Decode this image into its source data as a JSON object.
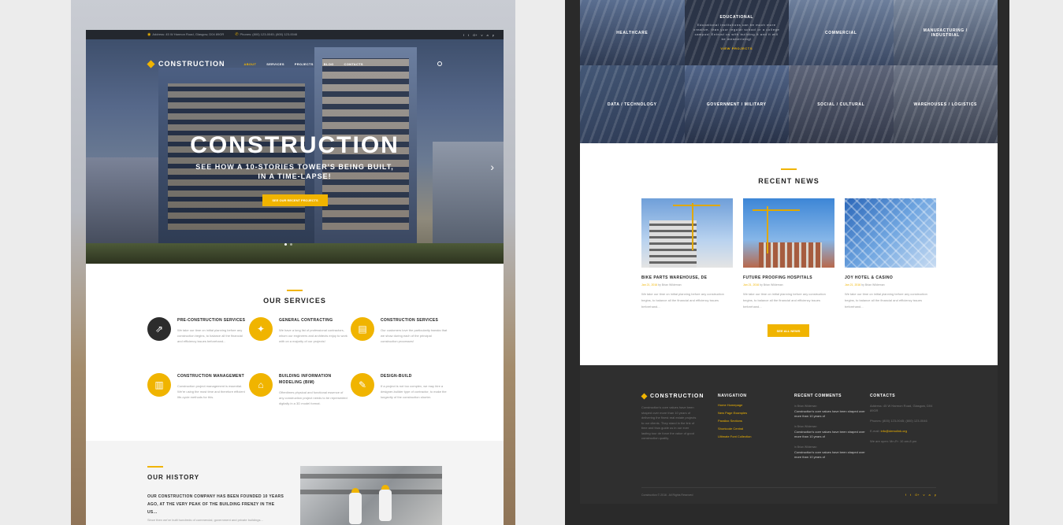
{
  "left": {
    "topbar": {
      "address": "Address: 45 W Harmon Road, Glasgow, D04 89GR",
      "phones": "Phones: (800) 123-0045; (800) 123-0046",
      "social": [
        "f",
        "t",
        "G+",
        "v",
        "a",
        "p"
      ]
    },
    "nav": {
      "logo": "CONSTRUCTION",
      "items": [
        "ABOUT",
        "SERVICES",
        "PROJECTS",
        "BLOG",
        "CONTACTS"
      ],
      "active": "ABOUT"
    },
    "hero": {
      "title": "CONSTRUCTION",
      "subtitle_line1": "SEE HOW A 10-STORIES TOWER'S BEING BUILT,",
      "subtitle_line2": "IN A TIME-LAPSE!",
      "button": "SEE OUR RECENT PROJECTS",
      "arrow": "›"
    },
    "services": {
      "title": "OUR SERVICES",
      "items": [
        {
          "name": "PRE-CONSTRUCTION SERVICES",
          "text": "We take our time on initial planning before any construction begins, to balance all the financial and efficiency issues beforehand...",
          "icon": "chart-icon",
          "glyph": "⇗"
        },
        {
          "name": "GENERAL CONTRACTING",
          "text": "We have a long list of professional contractors, whom our engineers and architects enjoy to work with on a majority of our projects!",
          "icon": "handshake-icon",
          "glyph": "✦"
        },
        {
          "name": "CONSTRUCTION SERVICES",
          "text": "Our customers love the particularity tweaks that we show during each of the principal construction processes!",
          "icon": "crane-icon",
          "glyph": "▤"
        },
        {
          "name": "CONSTRUCTION MANAGEMENT",
          "text": "Construction project management is essential. We're using the most time and therefore efficient life-cycle methods for this.",
          "icon": "clipboard-icon",
          "glyph": "▥"
        },
        {
          "name": "BUILDING INFORMATION MODELING (BIM)",
          "text": "Oftentimes physical and functional essence of any construction project needs to be represented digitally in a 3D model format.",
          "icon": "house-icon",
          "glyph": "⌂"
        },
        {
          "name": "DESIGN-BUILD",
          "text": "If a project is not too complex, we may hire a designer-builder type of contractor, to make the longevity of the construction shorter.",
          "icon": "pencil-icon",
          "glyph": "✎"
        }
      ]
    },
    "history": {
      "title": "OUR HISTORY",
      "text": "OUR CONSTRUCTION COMPANY HAS BEEN FOUNDED 10 YEARS AGO, AT THE VERY PEAK OF THE BUILDING FRENZY IN THE US...",
      "small": "Since then we've built hundreds of commercial, government and private buildings..."
    }
  },
  "right": {
    "tiles": [
      {
        "label": "HEALTHCARE"
      },
      {
        "label": "EDUCATIONAL",
        "desc": "Educational institutions can be much more creative, than your regular school or a college campus! Entrust us with building it and it will be mesmerizing!",
        "link": "VIEW PROJECTS"
      },
      {
        "label": "COMMERCIAL"
      },
      {
        "label": "MANUFACTURING / INDUSTRIAL"
      },
      {
        "label": "DATA / TECHNOLOGY"
      },
      {
        "label": "GOVERNMENT / MILITARY"
      },
      {
        "label": "SOCIAL / CULTURAL"
      },
      {
        "label": "WAREHOUSES / LOGISTICS"
      }
    ],
    "news": {
      "title": "RECENT NEWS",
      "posts": [
        {
          "title": "BIKE PARTS WAREHOUSE, DE",
          "date": "Jan 21, 2016",
          "by": "by Brian Wildeman",
          "text": "We take our time on initial planning before any construction begins, to balance all the financial and efficiency issues beforehand..."
        },
        {
          "title": "FUTURE PROOFING HOSPITALS",
          "date": "Jan 21, 2016",
          "by": "by Brian Wildeman",
          "text": "We take our time on initial planning before any construction begins, to balance all the financial and efficiency issues beforehand..."
        },
        {
          "title": "JOY HOTEL & CASINO",
          "date": "Jan 21, 2016",
          "by": "by Brian Wildeman",
          "text": "We take our time on initial planning before any construction begins, to balance all the financial and efficiency issues beforehand..."
        }
      ],
      "button": "SEE ALL NEWS"
    },
    "footer": {
      "logo": "CONSTRUCTION",
      "about": "Construction's core values have been shaped over more than 10 years of delivering the finest real estate projects to our clients. They stand in the link of time and thus guide us in our ever lasting tour de force the value of good construction quality.",
      "nav_title": "NAVIGATION",
      "nav_links": [
        "Home Homepage",
        "New Page Examples",
        "Parallax Sections",
        "Shortcode Central",
        "Ultimate Font Collection"
      ],
      "comments_title": "RECENT COMMENTS",
      "comments": [
        {
          "who": "in Brian Wildeman",
          "msg": "Construction's core values have been shaped over more than 10 years of"
        },
        {
          "who": "in Brian Wildeman",
          "msg": "Construction's core values have been shaped over more than 10 years of"
        },
        {
          "who": "in Brian Wildeman",
          "msg": "Construction's core values have been shaped over more than 10 years of"
        }
      ],
      "contacts_title": "CONTACTS",
      "address": "Address: 45 W Harmon Road, Glasgow, D04 89GR",
      "phones": "Phones: (800) 123-0045; (800) 123-0046",
      "email_label": "E-mail:",
      "email": "info@demolink.org",
      "hours": "We are open: Mn-Fr: 10 am-8 pm",
      "copyright": "Construction © 2016 . All Rights Reserved",
      "social": [
        "f",
        "t",
        "G+",
        "v",
        "a",
        "p"
      ]
    }
  }
}
